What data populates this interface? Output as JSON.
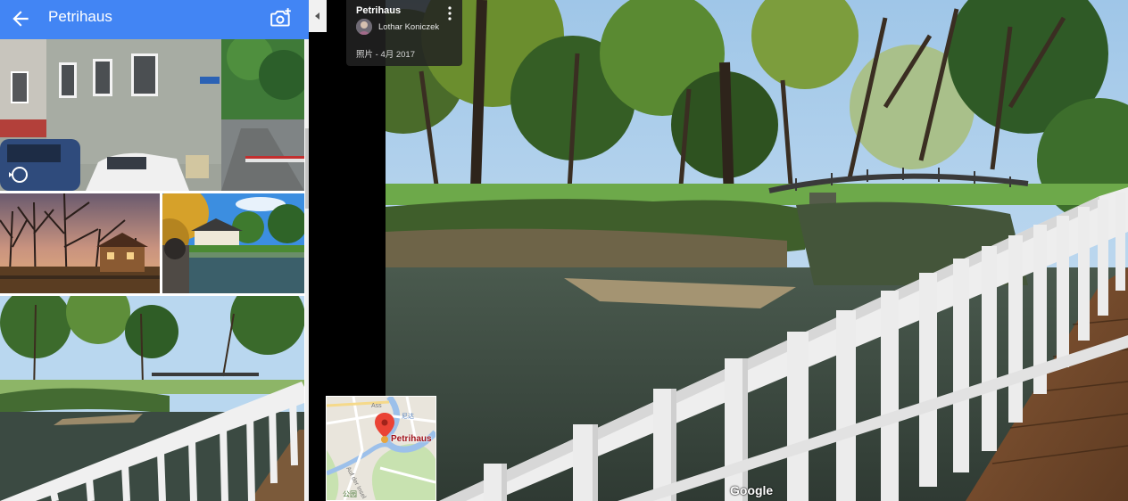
{
  "header": {
    "title": "Petrihaus",
    "back_icon": "arrow-back-icon",
    "add_photo_icon": "add-photo-icon",
    "background": "#4285f4"
  },
  "thumbnails": [
    {
      "subject": "building-street",
      "has_360_icon": true
    },
    {
      "subject": "sunset-trees"
    },
    {
      "subject": "house-by-river"
    },
    {
      "subject": "bridge-river",
      "selected": true
    }
  ],
  "photo_info": {
    "place": "Petrihaus",
    "author": "Lothar Koniczek",
    "date": "照片 - 4月 2017"
  },
  "mini_map": {
    "marker_label": "Petrihaus",
    "street_labels": [
      "Auf der Insel",
      "公园",
      "尼达",
      "Ass"
    ]
  },
  "brand": "Google"
}
